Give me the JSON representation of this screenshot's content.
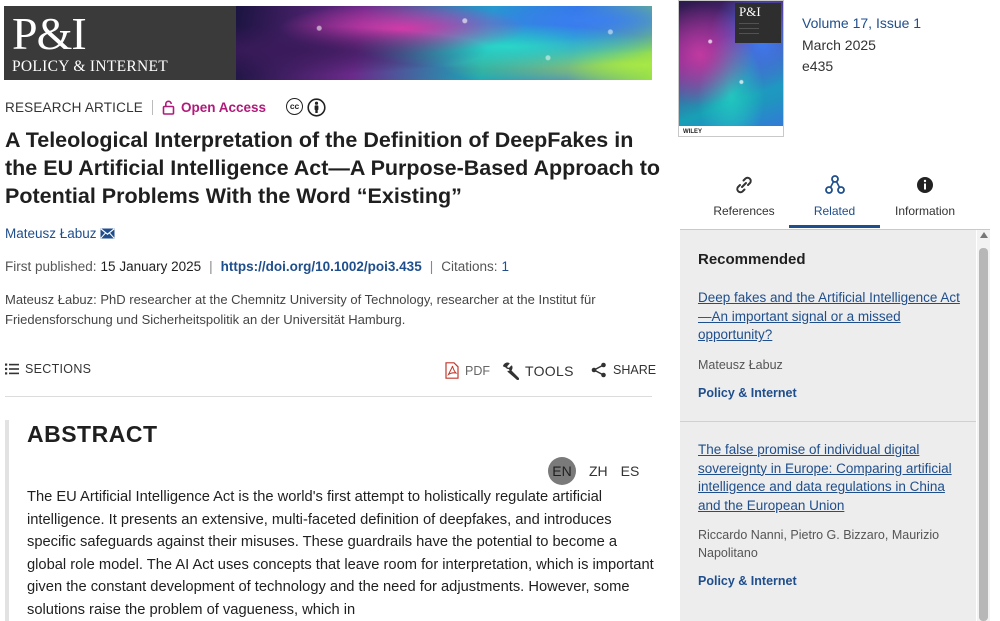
{
  "journal": {
    "logo_main": "P&I",
    "logo_sub": "POLICY & INTERNET"
  },
  "article": {
    "type": "RESEARCH ARTICLE",
    "access": "Open Access",
    "license_icons": [
      "cc-icon",
      "by-attribution-icon"
    ],
    "title": "A Teleological Interpretation of the Definition of DeepFakes in the EU Artificial Intelligence Act—A Purpose-Based Approach to Potential Problems With the Word “Existing”",
    "author": "Mateusz Łabuz",
    "first_published_label": "First published:",
    "first_published_date": "15 January 2025",
    "doi": "https://doi.org/10.1002/poi3.435",
    "citations_label": "Citations:",
    "citations_count": "1",
    "affiliation": "Mateusz Łabuz: PhD researcher at the Chemnitz University of Technology, researcher at the Institut für Friedensforschung und Sicherheitspolitik an der Universität Hamburg."
  },
  "toolbar": {
    "sections": "SECTIONS",
    "pdf": "PDF",
    "tools": "TOOLS",
    "share": "SHARE"
  },
  "abstract": {
    "heading": "ABSTRACT",
    "languages": [
      "EN",
      "ZH",
      "ES"
    ],
    "selected_language": "EN",
    "text": "The EU Artificial Intelligence Act is the world's first attempt to holistically regulate artificial intelligence. It presents an extensive, multi-faceted definition of deepfakes, and introduces specific safeguards against their misuses. These guardrails have the potential to become a global role model. The AI Act uses concepts that leave room for interpretation, which is important given the constant development of technology and the need for adjustments. However, some solutions raise the problem of vagueness, which in"
  },
  "issue": {
    "cover_logo": "P&I",
    "cover_publisher": "WILEY",
    "volume_issue": "Volume 17, Issue 1",
    "date": "March 2025",
    "article_id": "e435"
  },
  "tabs": [
    {
      "label": "References",
      "icon": "link-icon"
    },
    {
      "label": "Related",
      "icon": "network-icon",
      "active": true
    },
    {
      "label": "Information",
      "icon": "info-icon"
    }
  ],
  "recommended": {
    "heading": "Recommended",
    "items": [
      {
        "title": "Deep fakes and the Artificial Intelligence Act—An important signal or a missed opportunity?",
        "authors": "Mateusz Łabuz",
        "journal": "Policy & Internet"
      },
      {
        "title": "The false promise of individual digital sovereignty in Europe: Comparing artificial intelligence and data regulations in China and the European Union",
        "authors": "Riccardo Nanni, Pietro G. Bizzaro, Maurizio Napolitano",
        "journal": "Policy & Internet"
      }
    ]
  },
  "colors": {
    "link": "#1f4e8c",
    "open_access": "#b01a7a",
    "panel_bg": "#ededed"
  }
}
